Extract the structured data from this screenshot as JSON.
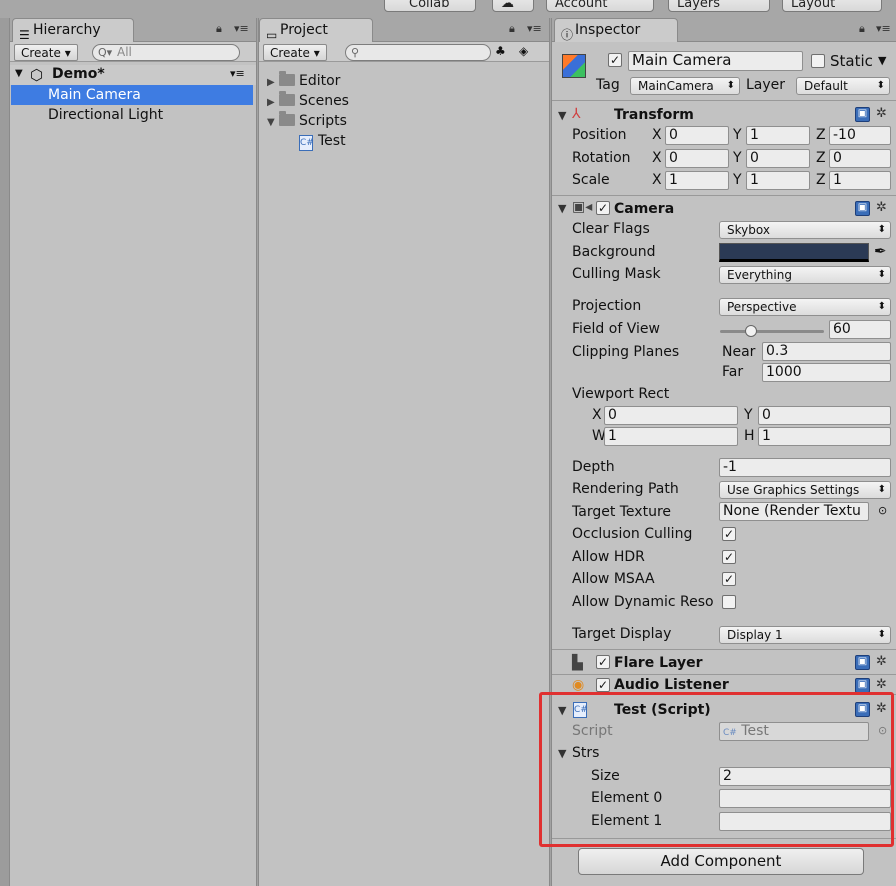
{
  "toolbar": {
    "collab": "Collab",
    "account": "Account",
    "layers": "Layers",
    "layout": "Layout"
  },
  "hierarchy": {
    "tab": "Hierarchy",
    "create": "Create",
    "search_placeholder": "All",
    "scene": "Demo*",
    "items": [
      "Main Camera",
      "Directional Light"
    ]
  },
  "project": {
    "tab": "Project",
    "create": "Create",
    "folders": [
      "Editor",
      "Scenes",
      "Scripts"
    ],
    "script": "Test"
  },
  "inspector": {
    "tab": "Inspector",
    "object_name": "Main Camera",
    "static_label": "Static",
    "tag_label": "Tag",
    "tag_value": "MainCamera",
    "layer_label": "Layer",
    "layer_value": "Default",
    "transform": {
      "title": "Transform",
      "position_label": "Position",
      "rotation_label": "Rotation",
      "scale_label": "Scale",
      "position": [
        "0",
        "1",
        "-10"
      ],
      "rotation": [
        "0",
        "0",
        "0"
      ],
      "scale": [
        "1",
        "1",
        "1"
      ],
      "x": "X",
      "y": "Y",
      "z": "Z"
    },
    "camera": {
      "title": "Camera",
      "clear_flags_label": "Clear Flags",
      "clear_flags": "Skybox",
      "background_label": "Background",
      "background_color": "#2b3a55",
      "culling_mask_label": "Culling Mask",
      "culling_mask": "Everything",
      "projection_label": "Projection",
      "projection": "Perspective",
      "fov_label": "Field of View",
      "fov": "60",
      "fov_fraction": 0.3,
      "clipping_label": "Clipping Planes",
      "near_label": "Near",
      "near": "0.3",
      "far_label": "Far",
      "far": "1000",
      "viewport_label": "Viewport Rect",
      "vx_label": "X",
      "vx": "0",
      "vy_label": "Y",
      "vy": "0",
      "vw_label": "W",
      "vw": "1",
      "vh_label": "H",
      "vh": "1",
      "depth_label": "Depth",
      "depth": "-1",
      "rendering_path_label": "Rendering Path",
      "rendering_path": "Use Graphics Settings",
      "target_texture_label": "Target Texture",
      "target_texture": "None (Render Textu",
      "occlusion_label": "Occlusion Culling",
      "hdr_label": "Allow HDR",
      "msaa_label": "Allow MSAA",
      "dynres_label": "Allow Dynamic Reso",
      "target_display_label": "Target Display",
      "target_display": "Display 1"
    },
    "flare_layer": "Flare Layer",
    "audio_listener": "Audio Listener",
    "test_script": {
      "title": "Test (Script)",
      "script_label": "Script",
      "script_value": "Test",
      "strs_label": "Strs",
      "size_label": "Size",
      "size": "2",
      "element0_label": "Element 0",
      "element0": "",
      "element1_label": "Element 1",
      "element1": ""
    },
    "add_component": "Add Component"
  },
  "colors": {
    "selection": "#3e7ce2",
    "highlight_box": "#e03030"
  }
}
